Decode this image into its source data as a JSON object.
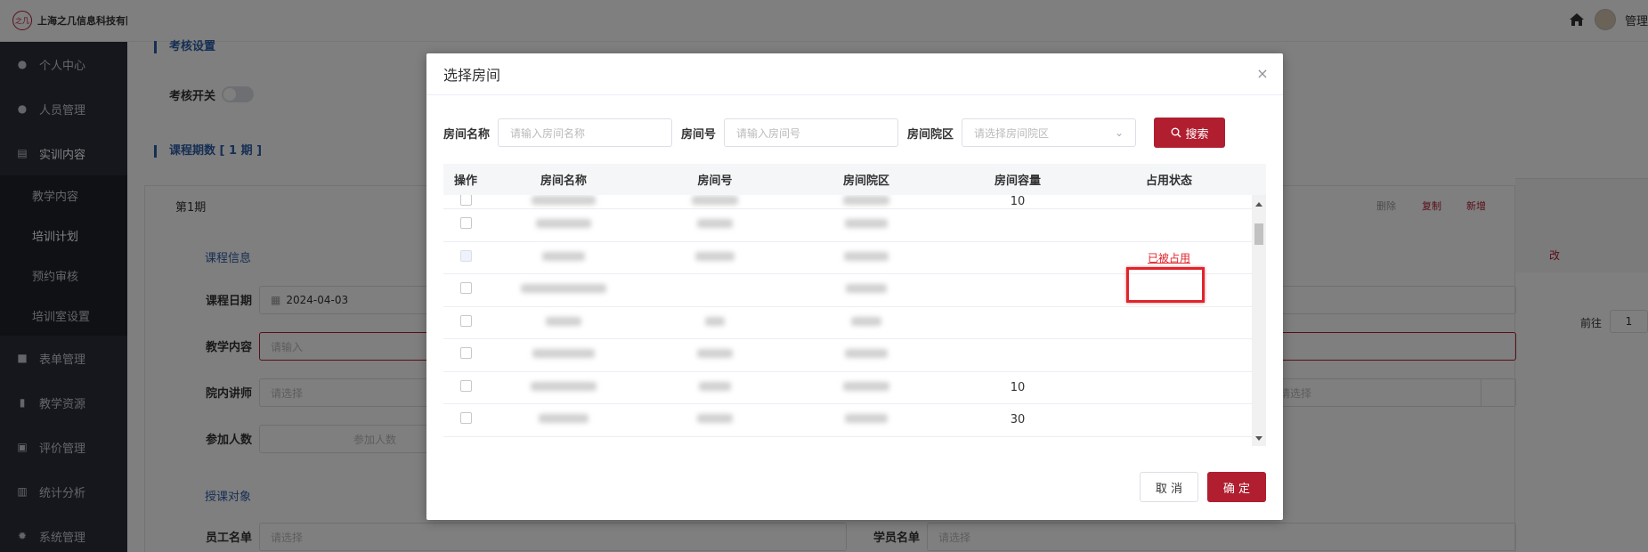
{
  "app": {
    "company": "上海之几信息科技有限",
    "logo_mark": "之几",
    "user_name": "管理"
  },
  "sidebar": {
    "items": [
      {
        "label": "个人中心",
        "icon": "user-icon"
      },
      {
        "label": "人员管理",
        "icon": "users-icon"
      },
      {
        "label": "实训内容",
        "icon": "book-icon"
      }
    ],
    "sub_items": [
      {
        "label": "教学内容"
      },
      {
        "label": "培训计划"
      },
      {
        "label": "预约审核"
      },
      {
        "label": "培训室设置"
      }
    ],
    "items_after": [
      {
        "label": "表单管理",
        "icon": "form-icon"
      },
      {
        "label": "教学资源",
        "icon": "resource-icon"
      },
      {
        "label": "评价管理",
        "icon": "rating-icon"
      },
      {
        "label": "统计分析",
        "icon": "chart-icon"
      },
      {
        "label": "系统管理",
        "icon": "gear-icon"
      }
    ]
  },
  "page": {
    "assessment_title": "考核设置",
    "assessment_switch_label": "考核开关",
    "periods_title": "课程期数 [ 1 期 ]",
    "period_name": "第1期",
    "actions": {
      "delete": "删除",
      "copy": "复制",
      "add": "新增"
    },
    "course_info_title": "课程信息",
    "course_date_label": "课程日期",
    "course_date_value": "2024-04-03",
    "teaching_content_label": "教学内容",
    "teaching_content_placeholder": "请输入",
    "lecturer_label": "院内讲师",
    "lecturer_placeholder": "请选择",
    "participants_label": "参加人数",
    "participants_placeholder": "参加人数",
    "target_title": "授课对象",
    "employee_list_label": "员工名单",
    "employee_placeholder": "请选择",
    "student_list_label": "学员名单",
    "student_placeholder": "请选择",
    "right_select_placeholder": "请选择",
    "right_edge_text": "改",
    "goto_label": "前往",
    "goto_page": "1"
  },
  "dialog": {
    "title": "选择房间",
    "filters": {
      "room_name_label": "房间名称",
      "room_name_placeholder": "请输入房间名称",
      "room_no_label": "房间号",
      "room_no_placeholder": "请输入房间号",
      "campus_label": "房间院区",
      "campus_placeholder": "请选择房间院区",
      "search_label": "搜索"
    },
    "columns": [
      "操作",
      "房间名称",
      "房间号",
      "房间院区",
      "房间容量",
      "占用状态"
    ],
    "rows": [
      {
        "capacity": "10",
        "status": ""
      },
      {
        "capacity": "",
        "status": ""
      },
      {
        "capacity": "",
        "status": "已被占用"
      },
      {
        "capacity": "",
        "status": ""
      },
      {
        "capacity": "",
        "status": ""
      },
      {
        "capacity": "",
        "status": ""
      },
      {
        "capacity": "10",
        "status": ""
      },
      {
        "capacity": "30",
        "status": ""
      }
    ],
    "cancel_label": "取 消",
    "confirm_label": "确 定"
  },
  "colors": {
    "brand": "#b01e2f",
    "link_blue": "#2d5fa8",
    "occupied_red": "#e0242b",
    "sidebar_bg": "#2b2f3a"
  }
}
